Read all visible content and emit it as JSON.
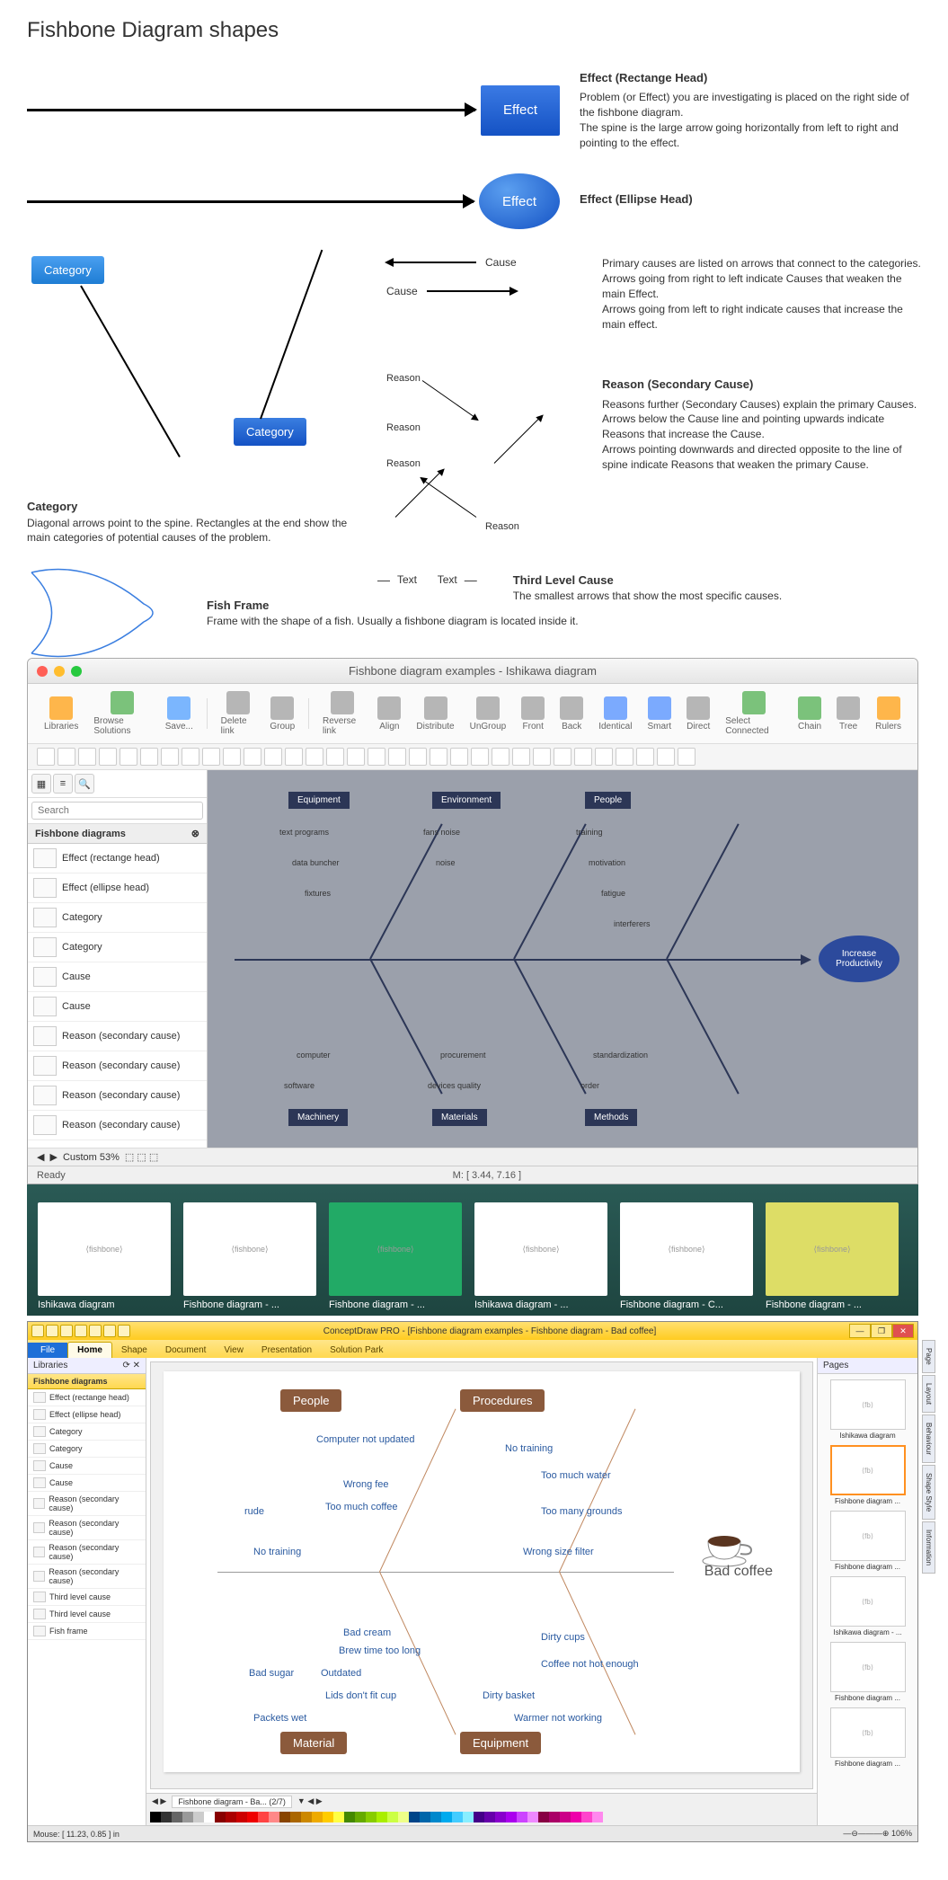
{
  "title": "Fishbone Diagram shapes",
  "effectRect": {
    "label": "Effect",
    "heading": "Effect (Rectange Head)",
    "desc": "Problem (or Effect) you are investigating is placed on the right side of the fishbone diagram.\nThe spine is the large arrow going horizontally from left to right and pointing to the effect."
  },
  "effectEllipse": {
    "label": "Effect",
    "heading": "Effect (Ellipse Head)"
  },
  "category": {
    "label1": "Category",
    "label2": "Category",
    "heading": "Category",
    "desc": "Diagonal arrows point to the spine. Rectangles at the end show the main categories of potential causes of the problem."
  },
  "cause": {
    "label": "Cause",
    "desc": "Primary causes are listed on arrows that connect to the categories.\nArrows going from right to left indicate Causes that weaken the main Effect.\nArrows going from left to right indicate causes that increase the main effect."
  },
  "reason": {
    "label": "Reason",
    "heading": "Reason (Secondary Cause)",
    "desc": "Reasons further (Secondary Causes) explain the primary Causes. Arrows below the Cause line and pointing upwards indicate Reasons that increase the Cause.\nArrows pointing downwards and directed opposite to the line of spine indicate Reasons that weaken the primary Cause."
  },
  "fishFrame": {
    "heading": "Fish Frame",
    "desc": "Frame with the shape of a fish. Usually a fishbone diagram is located inside it."
  },
  "thirdLevel": {
    "label": "Text",
    "heading": "Third Level Cause",
    "desc": "The smallest arrows that show the most specific causes."
  },
  "mac": {
    "title": "Fishbone diagram examples - Ishikawa diagram",
    "toolbar": [
      "Libraries",
      "Browse Solutions",
      "Save...",
      "",
      "Delete link",
      "Group",
      "",
      "Reverse link",
      "Align",
      "Distribute",
      "UnGroup",
      "Front",
      "Back",
      "Identical",
      "Smart",
      "Direct",
      "Select Connected",
      "Chain",
      "Tree",
      "Rulers"
    ],
    "search": {
      "placeholder": "Search"
    },
    "libHeader": "Fishbone diagrams",
    "libItems": [
      "Effect (rectange head)",
      "Effect (ellipse head)",
      "Category",
      "Category",
      "Cause",
      "Cause",
      "Reason (secondary cause)",
      "Reason (secondary cause)",
      "Reason (secondary cause)",
      "Reason (secondary cause)"
    ],
    "diagram": {
      "effect": "Increase Productivity",
      "topCats": [
        "Equipment",
        "Environment",
        "People"
      ],
      "botCats": [
        "Machinery",
        "Materials",
        "Methods"
      ],
      "topCauses": [
        [
          "text programs",
          "data buncher",
          "fixtures"
        ],
        [
          "fans noise",
          "noise"
        ],
        [
          "training",
          "motivation",
          "fatigue",
          "interferers"
        ]
      ],
      "botCauses": [
        [
          "software",
          "computer"
        ],
        [
          "devices quality",
          "procurement"
        ],
        [
          "order",
          "standardization"
        ]
      ]
    },
    "zoom": "Custom 53%",
    "status": "Ready",
    "mouse": "M: [ 3.44, 7.16 ]"
  },
  "thumbs": [
    "Ishikawa diagram",
    "Fishbone diagram - ...",
    "Fishbone diagram - ...",
    "Ishikawa diagram - ...",
    "Fishbone diagram - C...",
    "Fishbone diagram - ..."
  ],
  "win": {
    "title": "ConceptDraw PRO - [Fishbone diagram examples - Fishbone diagram - Bad coffee]",
    "ribbonTabs": [
      "File",
      "Home",
      "Shape",
      "Document",
      "View",
      "Presentation",
      "Solution Park"
    ],
    "leftHeader": "Libraries",
    "leftLib": "Fishbone diagrams",
    "leftItems": [
      "Effect (rectange head)",
      "Effect (ellipse head)",
      "Category",
      "Category",
      "Cause",
      "Cause",
      "Reason (secondary cause)",
      "Reason (secondary cause)",
      "Reason (secondary cause)",
      "Reason (secondary cause)",
      "Third level cause",
      "Third level cause",
      "Fish frame"
    ],
    "rightHeader": "Pages",
    "rightThumbs": [
      "Ishikawa diagram",
      "Fishbone diagram ...",
      "Fishbone diagram ...",
      "Ishikawa diagram - ...",
      "Fishbone diagram ...",
      "Fishbone diagram ..."
    ],
    "sideTabs": [
      "Page",
      "Layout",
      "Behaviour",
      "Shape Style",
      "Information"
    ],
    "diagram": {
      "effect": "Bad coffee",
      "topCats": [
        "People",
        "Procedures"
      ],
      "botCats": [
        "Material",
        "Equipment"
      ],
      "causes": {
        "people": [
          "Computer not updated",
          "Wrong fee",
          "Too much coffee",
          "rude",
          "No training"
        ],
        "procedures": [
          "No training",
          "Too much water",
          "Too many grounds",
          "Wrong size filter"
        ],
        "material": [
          "Bad cream",
          "Brew time too long",
          "Outdated",
          "Lids don't fit cup",
          "Bad sugar",
          "Packets wet"
        ],
        "equipment": [
          "Dirty cups",
          "Coffee not hot enough",
          "Dirty basket",
          "Warmer not working"
        ]
      }
    },
    "tabLabel": "Fishbone diagram - Ba... (2/7)",
    "mouse": "Mouse: [ 11.23, 0.85 ] in",
    "zoom": "106%"
  },
  "palette": [
    "#000",
    "#333",
    "#666",
    "#999",
    "#ccc",
    "#fff",
    "#800",
    "#a00",
    "#c00",
    "#e00",
    "#f44",
    "#f88",
    "#840",
    "#a60",
    "#c80",
    "#ea0",
    "#fc0",
    "#ff4",
    "#480",
    "#6a0",
    "#8c0",
    "#ae0",
    "#cf4",
    "#ef8",
    "#048",
    "#06a",
    "#08c",
    "#0ae",
    "#4cf",
    "#8ef",
    "#408",
    "#60a",
    "#80c",
    "#a0e",
    "#c4f",
    "#e8f",
    "#804",
    "#a06",
    "#c08",
    "#e0a",
    "#f4c",
    "#f8e"
  ]
}
